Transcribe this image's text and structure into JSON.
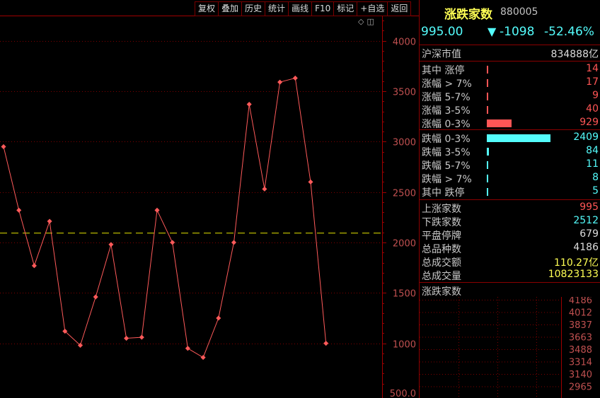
{
  "toolbar": {
    "items": [
      "复权",
      "叠加",
      "历史",
      "统计",
      "画线",
      "F10",
      "标记",
      "+自选",
      "返回"
    ]
  },
  "header": {
    "name": "涨跌家数",
    "code": "880005",
    "price": "995.00",
    "arrow": "▼",
    "change": "-1098",
    "change_pct": "-52.46%"
  },
  "market_cap": {
    "label": "沪深市值",
    "value": "834888亿"
  },
  "up_stats": [
    {
      "label": "其中 涨停",
      "value": "14",
      "bar_frac": 0.006
    },
    {
      "label": "涨幅 > 7%",
      "value": "17",
      "bar_frac": 0.007
    },
    {
      "label": "涨幅 5-7%",
      "value": "9",
      "bar_frac": 0.004
    },
    {
      "label": "涨幅 3-5%",
      "value": "40",
      "bar_frac": 0.017
    },
    {
      "label": "涨幅 0-3%",
      "value": "929",
      "bar_frac": 0.386
    }
  ],
  "down_stats": [
    {
      "label": "跌幅 0-3%",
      "value": "2409",
      "bar_frac": 1.0
    },
    {
      "label": "跌幅 3-5%",
      "value": "84",
      "bar_frac": 0.035
    },
    {
      "label": "跌幅 5-7%",
      "value": "11",
      "bar_frac": 0.005
    },
    {
      "label": "跌幅 > 7%",
      "value": "8",
      "bar_frac": 0.004
    },
    {
      "label": "其中 跌停",
      "value": "5",
      "bar_frac": 0.003
    }
  ],
  "summary": [
    {
      "label": "上涨家数",
      "value": "995",
      "color": "#ff5555"
    },
    {
      "label": "下跌家数",
      "value": "2512",
      "color": "#54fcfc"
    },
    {
      "label": "平盘停牌",
      "value": "679",
      "color": "#dcdcdc"
    },
    {
      "label": "总品种数",
      "value": "4186",
      "color": "#dcdcdc"
    },
    {
      "label": "总成交额",
      "value": "110.27亿",
      "color": "#ffff54"
    },
    {
      "label": "总成交量",
      "value": "10823133",
      "color": "#ffff54"
    }
  ],
  "mini_chart": {
    "title": "涨跌家数",
    "ticks": [
      "4186",
      "4012",
      "3837",
      "3663",
      "3488",
      "3314",
      "3140",
      "2965"
    ]
  },
  "chart_data": {
    "type": "line",
    "series": [
      {
        "values": [
          2950,
          2320,
          1770,
          2210,
          1120,
          980,
          1460,
          1980,
          1050,
          1060,
          2320,
          2000,
          950,
          860,
          1250,
          2000,
          3370,
          2530,
          3590,
          3630,
          2600,
          1000
        ]
      }
    ],
    "reference_line": 2093,
    "ylim": [
      500,
      4250
    ],
    "yticks": [
      4000,
      3500,
      3000,
      2500,
      2000,
      1500,
      1000
    ],
    "ytick_labels": [
      "4000",
      "3500",
      "3000",
      "2500",
      "2000",
      "1500",
      "1000"
    ],
    "ybottom_label": "500.0",
    "colors": {
      "line": "#ff5a5a",
      "reference": "#e6e600",
      "grid": "#800000",
      "axis": "#a00000"
    }
  }
}
